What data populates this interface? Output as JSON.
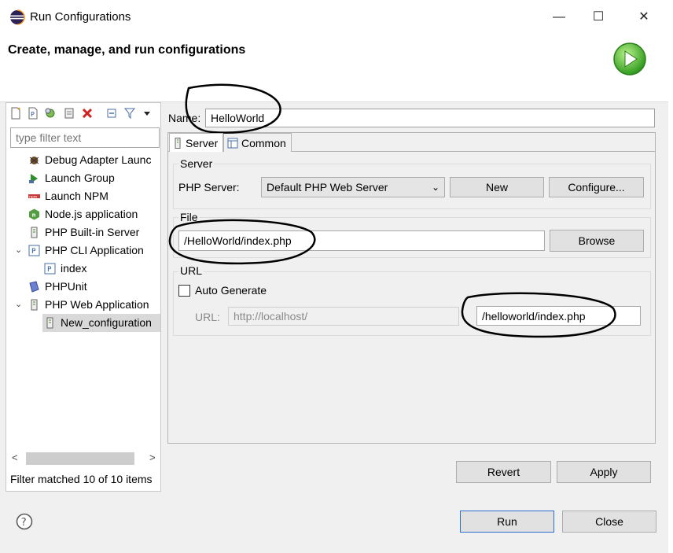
{
  "window": {
    "title": "Run Configurations",
    "minimize_glyph": "—",
    "maximize_glyph": "☐",
    "close_glyph": "✕"
  },
  "header": {
    "title": "Create, manage, and run configurations",
    "logo_icon": "run-play-icon"
  },
  "left_panel": {
    "toolbar_icons": [
      "new-configuration-icon",
      "new-prototype-icon",
      "duplicate-icon",
      "export-icon",
      "delete-icon",
      "collapse-all-icon",
      "filter-icon",
      "view-menu-icon"
    ],
    "filter_placeholder": "type filter text",
    "tree": [
      {
        "label": "Debug Adapter Launc",
        "icon": "debug-adapter-icon",
        "level": 0
      },
      {
        "label": "Launch Group",
        "icon": "launch-group-icon",
        "level": 0
      },
      {
        "label": "Launch NPM",
        "icon": "npm-icon",
        "level": 0
      },
      {
        "label": "Node.js application",
        "icon": "nodejs-icon",
        "level": 0
      },
      {
        "label": "PHP Built-in Server",
        "icon": "php-server-icon",
        "level": 0
      },
      {
        "label": "PHP CLI Application",
        "icon": "php-cli-icon",
        "level": 0,
        "expanded": true
      },
      {
        "label": "index",
        "icon": "php-file-icon",
        "level": 1
      },
      {
        "label": "PHPUnit",
        "icon": "phpunit-icon",
        "level": 0
      },
      {
        "label": "PHP Web Application",
        "icon": "php-web-icon",
        "level": 0,
        "expanded": true
      },
      {
        "label": "New_configuration",
        "icon": "php-web-config-icon",
        "level": 1,
        "selected": true
      }
    ],
    "filter_status": "Filter matched 10 of 10 items"
  },
  "config": {
    "name_label": "Name:",
    "name_value": "HelloWorld",
    "tabs": [
      {
        "label": "Server",
        "icon": "server-tab-icon",
        "active": true
      },
      {
        "label": "Common",
        "icon": "common-tab-icon",
        "active": false
      }
    ],
    "server_group": {
      "title": "Server",
      "php_server_label": "PHP Server:",
      "php_server_value": "Default PHP Web Server",
      "new_button": "New",
      "configure_button": "Configure..."
    },
    "file_group": {
      "title": "File",
      "file_value": "/HelloWorld/index.php",
      "browse_button": "Browse"
    },
    "url_group": {
      "title": "URL",
      "auto_generate_label": "Auto Generate",
      "auto_generate_checked": false,
      "url_label": "URL:",
      "url_base": "http://localhost/",
      "url_path": "/helloworld/index.php"
    },
    "revert_button": "Revert",
    "apply_button": "Apply"
  },
  "footer": {
    "run_button": "Run",
    "close_button": "Close",
    "help_icon": "help-icon"
  }
}
